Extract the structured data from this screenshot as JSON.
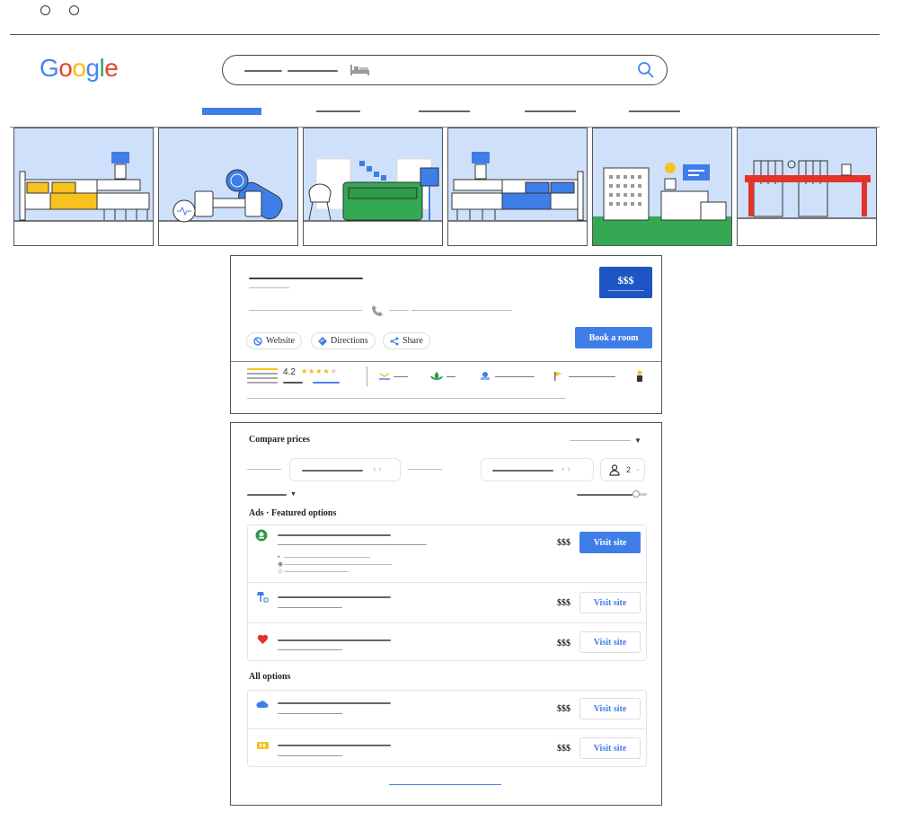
{
  "browser": {
    "controls": [
      "circle-1",
      "circle-2"
    ]
  },
  "header": {
    "logo_text": "Google",
    "search_icon": "magnifier-icon",
    "hotel_icon": "bed-icon"
  },
  "tabs": {
    "count": 5,
    "active_index": 0
  },
  "hotel": {
    "price_badge": "$$$",
    "website_label": "Website",
    "directions_label": "Directions",
    "share_label": "Share",
    "book_label": "Book a room",
    "rating": "4.2",
    "stars": 4
  },
  "compare": {
    "title": "Compare prices",
    "guests": "2",
    "featured_title": "Ads · Featured options",
    "all_title": "All options",
    "featured": [
      {
        "icon": "green-circle-logo-icon",
        "price": "$$$",
        "button": "Visit site",
        "primary": true
      },
      {
        "icon": "blue-lamp-logo-icon",
        "price": "$$$",
        "button": "Visit site",
        "primary": false
      },
      {
        "icon": "red-heart-logo-icon",
        "price": "$$$",
        "button": "Visit site",
        "primary": false
      }
    ],
    "all": [
      {
        "icon": "blue-cloud-logo-icon",
        "price": "$$$",
        "button": "Visit site"
      },
      {
        "icon": "yellow-tag-logo-icon",
        "price": "$$$",
        "button": "Visit site"
      }
    ]
  },
  "colors": {
    "accent": "#3f7ee8",
    "badge": "#1d56c4",
    "star": "#f4b400",
    "sky": "#cfe0fb",
    "grass": "#34a853",
    "red": "#e2342a"
  }
}
